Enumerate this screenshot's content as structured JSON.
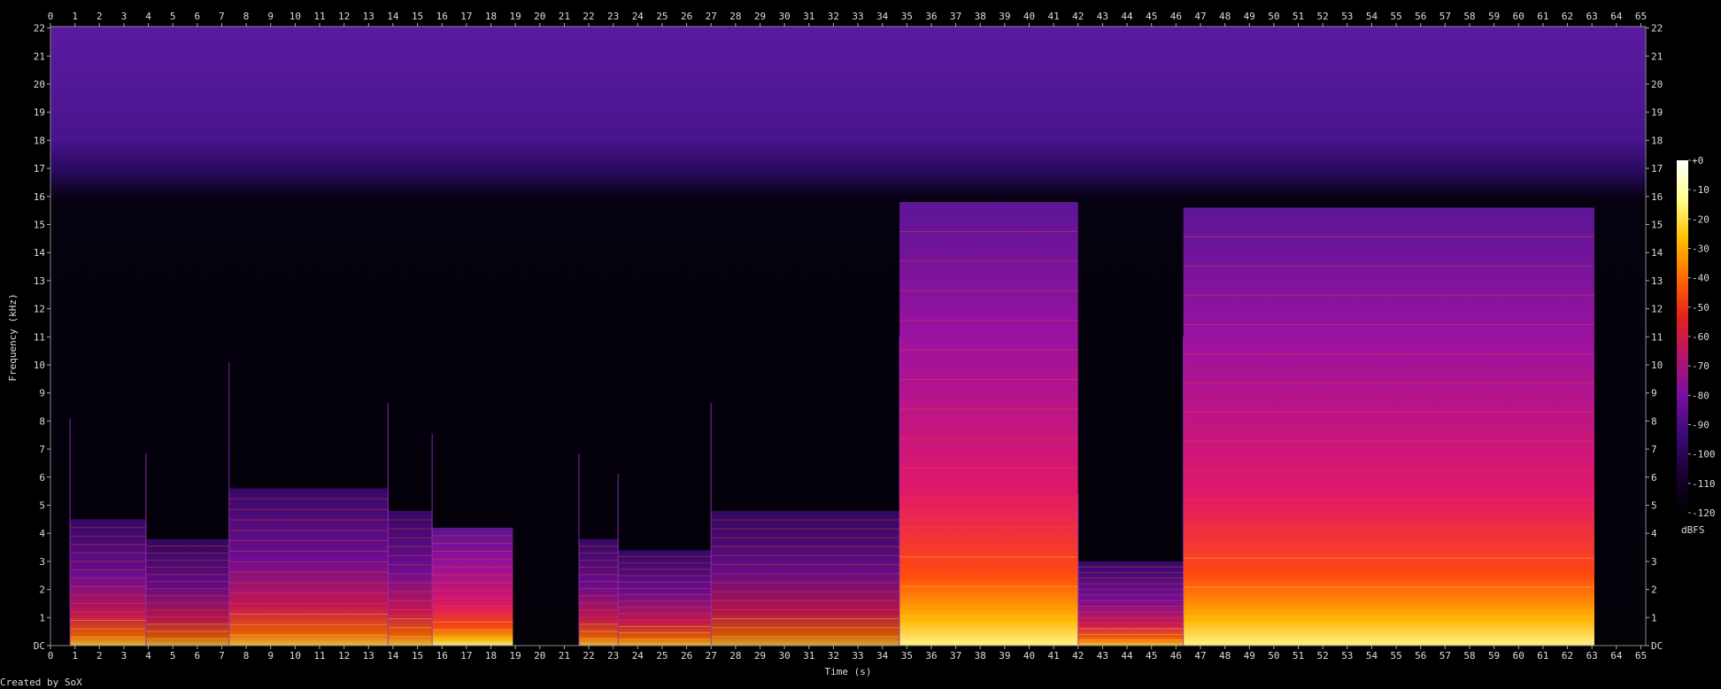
{
  "chart_data": {
    "type": "heatmap",
    "subtype": "spectrogram",
    "xlabel": "Time (s)",
    "ylabel": "Frequency (kHz)",
    "xlim": [
      0,
      65.2
    ],
    "ylim": [
      0,
      22.05
    ],
    "x_ticks": [
      "0",
      "1",
      "2",
      "3",
      "4",
      "5",
      "6",
      "7",
      "8",
      "9",
      "10",
      "11",
      "12",
      "13",
      "14",
      "15",
      "16",
      "17",
      "18",
      "19",
      "20",
      "21",
      "22",
      "23",
      "24",
      "25",
      "26",
      "27",
      "28",
      "29",
      "30",
      "31",
      "32",
      "33",
      "34",
      "35",
      "36",
      "37",
      "38",
      "39",
      "40",
      "41",
      "42",
      "43",
      "44",
      "45",
      "46",
      "47",
      "48",
      "49",
      "50",
      "51",
      "52",
      "53",
      "54",
      "55",
      "56",
      "57",
      "58",
      "59",
      "60",
      "61",
      "62",
      "63",
      "64",
      "65"
    ],
    "y_ticks": [
      "DC",
      "1",
      "2",
      "3",
      "4",
      "5",
      "6",
      "7",
      "8",
      "9",
      "10",
      "11",
      "12",
      "13",
      "14",
      "15",
      "16",
      "17",
      "18",
      "19",
      "20",
      "21",
      "22"
    ],
    "colorbar": {
      "label": "dBFS",
      "ticks": [
        "+0",
        "-10",
        "-20",
        "-30",
        "-40",
        "-50",
        "-60",
        "-70",
        "-80",
        "-90",
        "-100",
        "-110",
        "-120"
      ],
      "range_db": [
        -120,
        0
      ],
      "colors": [
        "#000000",
        "#1a0033",
        "#3c0a78",
        "#7a0fa0",
        "#b4146e",
        "#e6201e",
        "#ff6a00",
        "#ffc000",
        "#ffff8c",
        "#ffffff"
      ]
    },
    "segments": [
      {
        "start": 0.8,
        "end": 3.9,
        "top_khz": 4.5,
        "level": 0.78
      },
      {
        "start": 3.9,
        "end": 7.3,
        "top_khz": 3.8,
        "level": 0.72
      },
      {
        "start": 7.3,
        "end": 13.8,
        "top_khz": 5.6,
        "level": 0.8
      },
      {
        "start": 13.8,
        "end": 15.6,
        "top_khz": 4.8,
        "level": 0.8
      },
      {
        "start": 15.6,
        "end": 18.9,
        "top_khz": 4.2,
        "level": 0.86
      },
      {
        "start": 21.6,
        "end": 23.2,
        "top_khz": 3.8,
        "level": 0.78
      },
      {
        "start": 23.2,
        "end": 27.0,
        "top_khz": 3.4,
        "level": 0.78
      },
      {
        "start": 27.0,
        "end": 34.7,
        "top_khz": 4.8,
        "level": 0.72
      },
      {
        "start": 34.7,
        "end": 42.0,
        "top_khz": 15.8,
        "level": 0.9
      },
      {
        "start": 42.0,
        "end": 46.3,
        "top_khz": 3.0,
        "level": 0.84
      },
      {
        "start": 46.3,
        "end": 63.1,
        "top_khz": 15.6,
        "level": 0.92
      }
    ],
    "noise_floor_top_khz": 16.5,
    "grid": false
  },
  "footer": {
    "credit": "Created by SoX"
  },
  "colors": {
    "background": "#000000",
    "text": "#dcdcdc",
    "axis": "#aaaaaa"
  }
}
